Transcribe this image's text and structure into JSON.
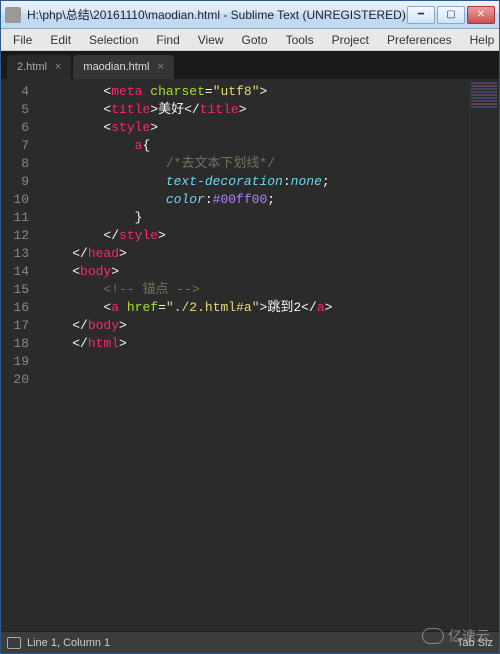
{
  "window": {
    "title": "H:\\php\\总结\\20161110\\maodian.html - Sublime Text (UNREGISTERED)"
  },
  "menu": {
    "file": "File",
    "edit": "Edit",
    "selection": "Selection",
    "find": "Find",
    "view": "View",
    "goto": "Goto",
    "tools": "Tools",
    "project": "Project",
    "preferences": "Preferences",
    "help": "Help"
  },
  "tabs": [
    {
      "label": "2.html",
      "active": false
    },
    {
      "label": "maodian.html",
      "active": true
    }
  ],
  "gutter": [
    "4",
    "5",
    "6",
    "7",
    "8",
    "9",
    "10",
    "11",
    "12",
    "13",
    "14",
    "15",
    "16",
    "17",
    "18",
    "19",
    "20"
  ],
  "code": {
    "l4": {
      "ind": "        ",
      "p1": "<",
      "tag1": "meta",
      "sp": " ",
      "attr": "charset",
      "eq": "=",
      "val": "\"utf8\"",
      "p2": ">"
    },
    "l5": {
      "ind": "        ",
      "p1": "<",
      "tag": "title",
      "p2": ">",
      "txt": "美好",
      "p3": "</",
      "p4": ">"
    },
    "l6": {
      "ind": "        ",
      "p1": "<",
      "tag": "style",
      "p2": ">"
    },
    "l7": {
      "ind": "            ",
      "sel": "a",
      "brace": "{"
    },
    "l8": {
      "ind": "                ",
      "cmt": "/*去文本下划线*/"
    },
    "l9": {
      "ind": "                ",
      "prop": "text-decoration",
      "colon": ":",
      "val": "none",
      "semi": ";"
    },
    "l10": {
      "ind": "                ",
      "prop": "color",
      "colon": ":",
      "val": "#00ff00",
      "semi": ";"
    },
    "l11": {
      "ind": "            ",
      "brace": "}"
    },
    "l12": {
      "ind": "        ",
      "p1": "</",
      "tag": "style",
      "p2": ">"
    },
    "l13": {
      "ind": "    ",
      "p1": "</",
      "tag": "head",
      "p2": ">"
    },
    "l14": {
      "ind": "    ",
      "p1": "<",
      "tag": "body",
      "p2": ">"
    },
    "l15": {
      "ind": "        ",
      "cmt": "<!-- 锚点 -->"
    },
    "l16": {
      "ind": "        ",
      "p1": "<",
      "tag": "a",
      "sp": " ",
      "attr": "href",
      "eq": "=",
      "val": "\"./2.html#a\"",
      "p2": ">",
      "txt": "跳到2",
      "p3": "</",
      "p4": ">"
    },
    "l17": {
      "ind": "    ",
      "p1": "</",
      "tag": "body",
      "p2": ">"
    },
    "l18": {
      "ind": "    ",
      "p1": "</",
      "tag": "html",
      "p2": ">"
    }
  },
  "status": {
    "pos": "Line 1, Column 1",
    "right": "Tab Siz"
  },
  "watermark": "亿速云"
}
